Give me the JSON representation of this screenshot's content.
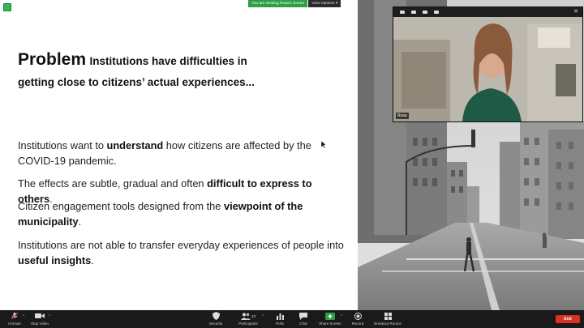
{
  "window": {
    "share_banner": {
      "viewing": "You are viewing Rosa's screen",
      "view_options": "View Options"
    }
  },
  "slide": {
    "title_main": "Problem",
    "title_rest_line1": "Institutions have difficulties in",
    "title_rest_line2": "getting close to citizens’ actual experiences...",
    "bullets": [
      {
        "pre": "Institutions want to ",
        "bold": "understand",
        "post": " how citizens are affected by the COVID-19 pandemic."
      },
      {
        "pre": "The effects are subtle, gradual and often ",
        "bold": "difficult to express to others",
        "post": "."
      },
      {
        "pre": "Citizen engagement tools designed from the ",
        "bold": "viewpoint of the municipality",
        "post": "."
      },
      {
        "pre": "Institutions are not able to transfer everyday experiences of people into ",
        "bold": "useful insights",
        "post": "."
      }
    ]
  },
  "webcam": {
    "participant_name": "Rosa"
  },
  "toolbar": {
    "items": [
      {
        "label": "Unmute",
        "icon": "mic-muted-icon"
      },
      {
        "label": "Stop Video",
        "icon": "video-icon"
      },
      {
        "label": "Security",
        "icon": "shield-icon"
      },
      {
        "label": "Participants",
        "icon": "participants-icon",
        "count": "23"
      },
      {
        "label": "Polls",
        "icon": "polls-icon"
      },
      {
        "label": "Chat",
        "icon": "chat-icon"
      },
      {
        "label": "Share Screen",
        "icon": "share-screen-icon"
      },
      {
        "label": "Record",
        "icon": "record-icon"
      },
      {
        "label": "Breakout Rooms",
        "icon": "breakout-rooms-icon"
      }
    ],
    "end_label": "End"
  },
  "colors": {
    "share_green": "#2f9e44",
    "end_red": "#d93025",
    "toolbar_bg": "#1a1a1a"
  }
}
